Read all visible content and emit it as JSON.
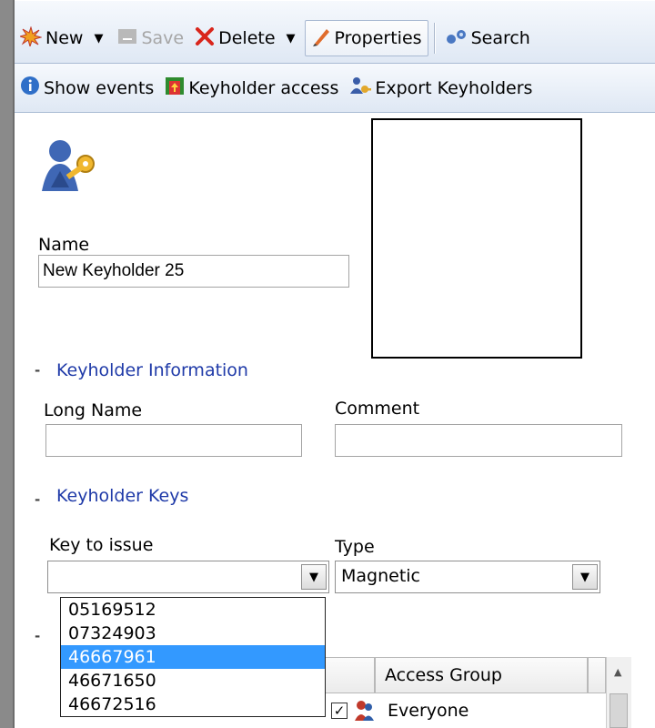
{
  "toolbar_primary": {
    "new_label": "New",
    "save_label": "Save",
    "delete_label": "Delete",
    "properties_label": "Properties",
    "search_label": "Search"
  },
  "toolbar_secondary": {
    "show_events_label": "Show events",
    "keyholder_access_label": "Keyholder access",
    "export_keyholders_label": "Export Keyholders"
  },
  "form": {
    "name_label": "Name",
    "name_value": "New Keyholder 25"
  },
  "keyholder_information": {
    "title": "Keyholder Information",
    "long_name_label": "Long Name",
    "long_name_value": "",
    "comment_label": "Comment",
    "comment_value": ""
  },
  "keyholder_keys": {
    "title": "Keyholder Keys",
    "key_to_issue_label": "Key to issue",
    "key_to_issue_value": "",
    "type_label": "Type",
    "type_value": "Magnetic",
    "key_options": [
      "05169512",
      "07324903",
      "46667961",
      "46671650",
      "46672516"
    ],
    "selected_option_index": 2
  },
  "access_groups": {
    "column_header": "Access Group",
    "rows": [
      {
        "name": "Everyone",
        "checked": true
      }
    ]
  },
  "icons": {
    "new": "starburst-icon",
    "save": "save-icon",
    "delete": "red-x-icon",
    "properties": "pencil-icon",
    "search": "binoculars-icon",
    "show_events": "info-icon",
    "keyholder_access": "door-icon",
    "export_keyholders": "people-export-icon",
    "keyholder": "keyholder-icon"
  }
}
